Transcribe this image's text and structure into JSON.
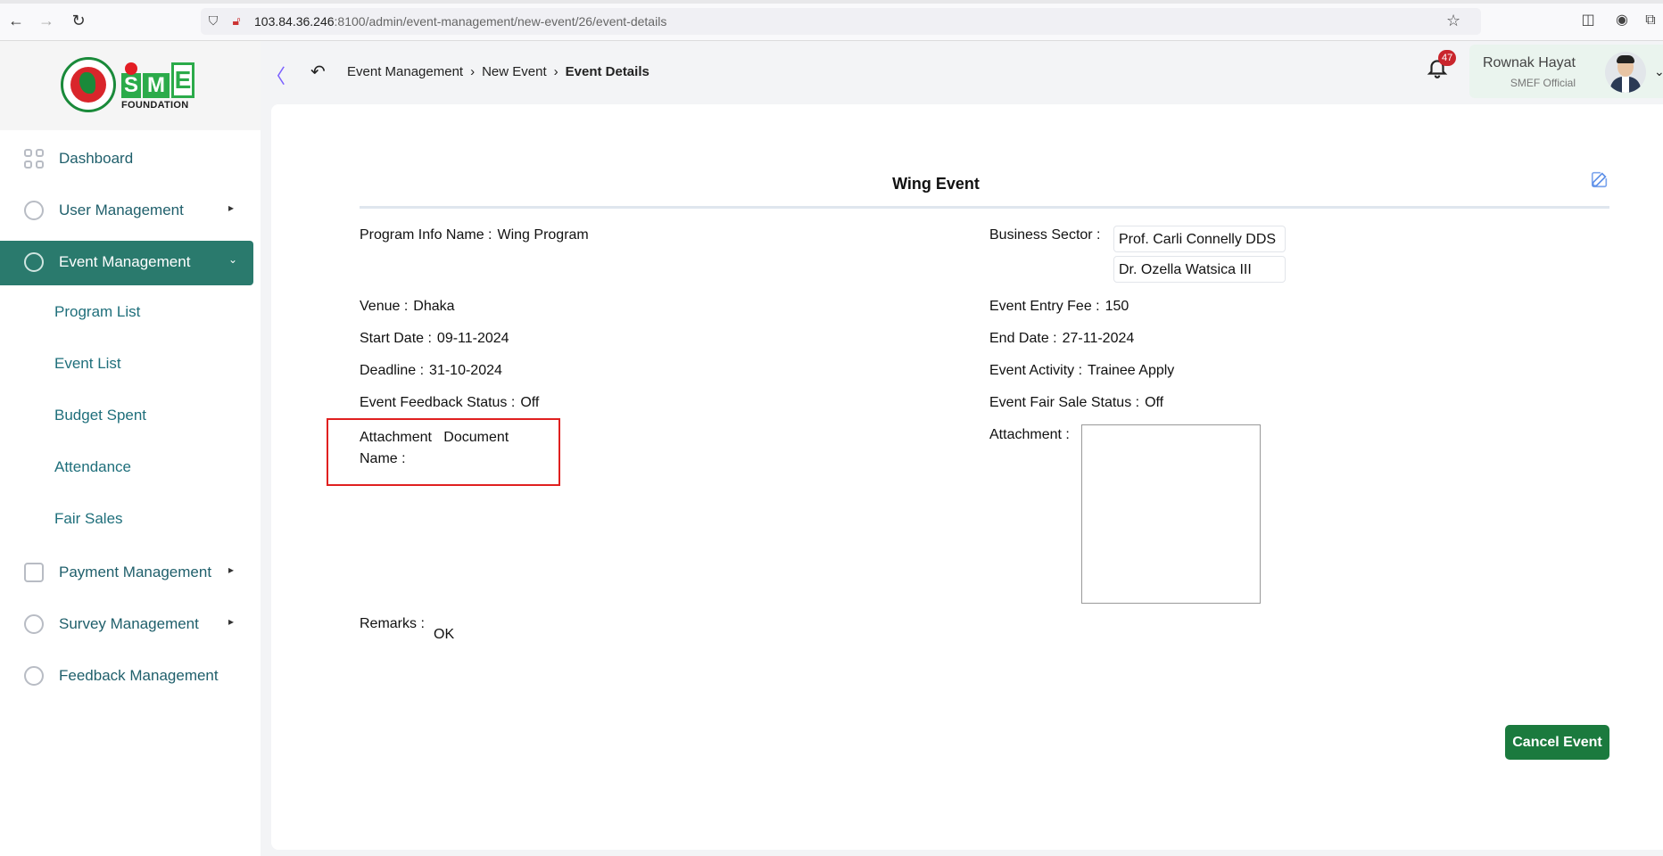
{
  "browser": {
    "url_host": "103.84.36.246",
    "url_rest": ":8100/admin/event-management/new-event/26/event-details"
  },
  "brand": {
    "logo_text": "SME",
    "foundation": "FOUNDATION"
  },
  "sidebar": {
    "items": [
      {
        "label": "Dashboard"
      },
      {
        "label": "User Management"
      },
      {
        "label": "Event Management"
      },
      {
        "label": "Payment Management"
      },
      {
        "label": "Survey Management"
      },
      {
        "label": "Feedback Management"
      }
    ],
    "subitems": [
      {
        "label": "Program List"
      },
      {
        "label": "Event List"
      },
      {
        "label": "Budget Spent"
      },
      {
        "label": "Attendance"
      },
      {
        "label": "Fair Sales"
      }
    ]
  },
  "header": {
    "breadcrumb": [
      "Event Management",
      "New Event",
      "Event Details"
    ],
    "notification_count": "47",
    "user_name": "Rownak Hayat",
    "user_role": "SMEF Official"
  },
  "event": {
    "title": "Wing Event",
    "program_info_label": "Program Info Name :",
    "program_info_value": "Wing Program",
    "business_sector_label": "Business Sector :",
    "business_sectors": [
      "Prof. Carli Connelly DDS",
      "Dr. Ozella Watsica III"
    ],
    "venue_label": "Venue :",
    "venue_value": "Dhaka",
    "entry_fee_label": "Event Entry Fee :",
    "entry_fee_value": "150",
    "start_date_label": "Start Date :",
    "start_date_value": "09-11-2024",
    "end_date_label": "End Date :",
    "end_date_value": "27-11-2024",
    "deadline_label": "Deadline :",
    "deadline_value": "31-10-2024",
    "activity_label": "Event Activity :",
    "activity_value": "Trainee Apply",
    "feedback_label": "Event Feedback Status :",
    "feedback_value": "Off",
    "fair_sale_label": "Event Fair Sale Status :",
    "fair_sale_value": "Off",
    "attachment_doc_label_1": "Attachment   Document",
    "attachment_doc_label_2": "Name :",
    "attachment_label": "Attachment :",
    "remarks_label": "Remarks :",
    "remarks_value": "OK",
    "cancel_label": "Cancel Event"
  }
}
